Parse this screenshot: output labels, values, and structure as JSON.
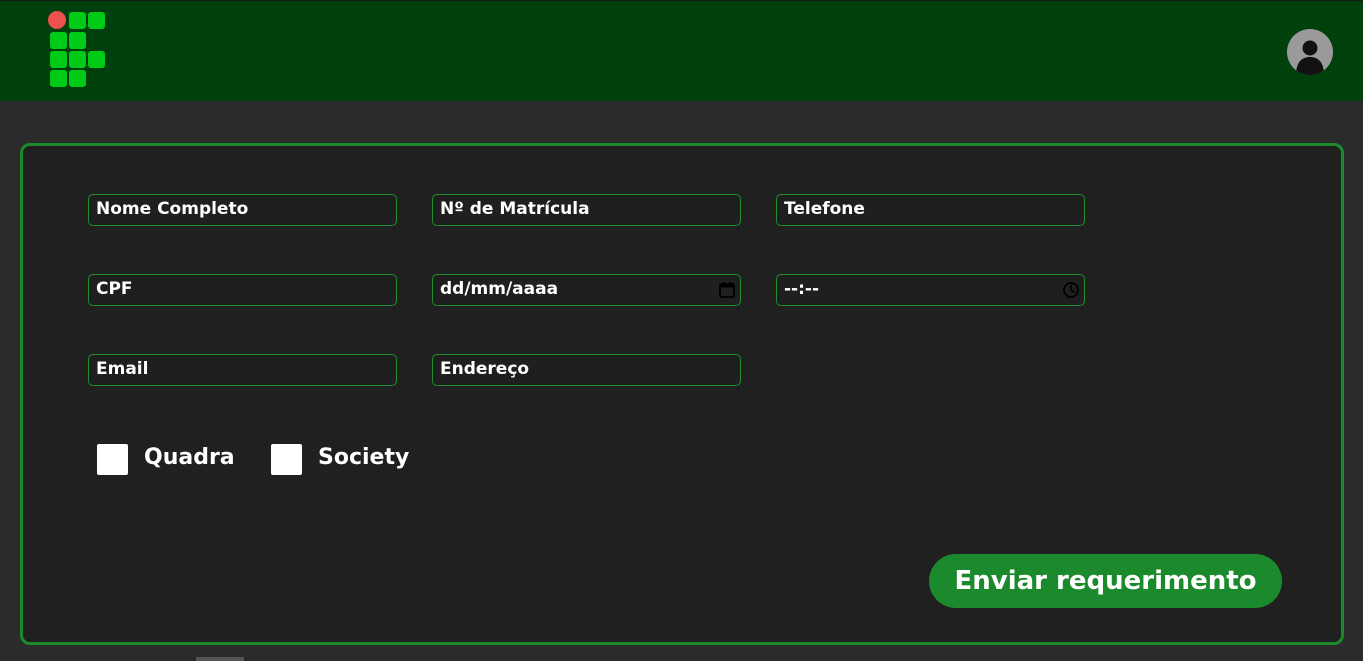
{
  "header": {
    "logo_icon": "institute-logo-icon",
    "avatar_icon": "user-avatar-icon"
  },
  "form": {
    "fields": {
      "nome": "Nome Completo",
      "matricula": "Nº de Matrícula",
      "telefone": "Telefone",
      "cpf": "CPF",
      "data": "dd/mm/aaaa",
      "hora": "--:--",
      "email": "Email",
      "endereco": "Endereço"
    },
    "checkboxes": {
      "quadra": "Quadra",
      "society": "Society"
    },
    "submit_label": "Enviar requerimento"
  },
  "colors": {
    "header_bg": "#00400d",
    "page_bg": "#2b2b2b",
    "card_bg": "#202020",
    "accent": "#1b8a2c",
    "logo_green": "#00cc18",
    "logo_red": "#ee5050"
  }
}
